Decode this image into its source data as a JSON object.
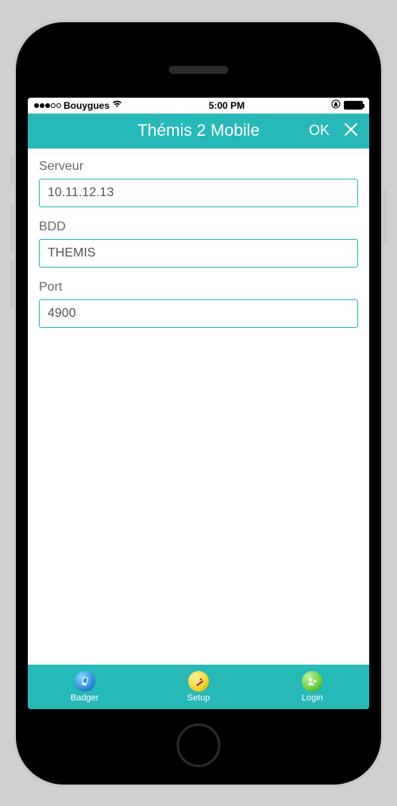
{
  "status": {
    "carrier": "Bouygues",
    "time": "5:00 PM"
  },
  "header": {
    "title": "Thémis 2 Mobile",
    "ok_label": "OK"
  },
  "form": {
    "serveur": {
      "label": "Serveur",
      "value": "10.11.12.13"
    },
    "bdd": {
      "label": "BDD",
      "value": "THEMIS"
    },
    "port": {
      "label": "Port",
      "value": "4900"
    }
  },
  "tabs": {
    "badger": {
      "label": "Badger"
    },
    "setup": {
      "label": "Setup"
    },
    "login": {
      "label": "Login"
    }
  }
}
